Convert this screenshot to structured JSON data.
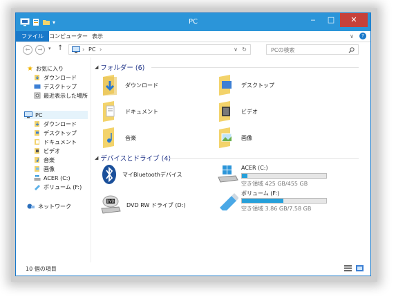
{
  "window": {
    "title": "PC"
  },
  "ribbon": {
    "tabs": [
      "ファイル",
      "コンピューター",
      "表示"
    ]
  },
  "address": {
    "path": [
      "PC"
    ],
    "search_placeholder": "PCの検索"
  },
  "nav": {
    "favorites_label": "お気に入り",
    "favorites": [
      "ダウンロード",
      "デスクトップ",
      "最近表示した場所"
    ],
    "pc_label": "PC",
    "pc_items": [
      "ダウンロード",
      "デスクトップ",
      "ドキュメント",
      "ビデオ",
      "音楽",
      "画像",
      "ACER (C:)",
      "ボリューム (F:)"
    ],
    "network_label": "ネットワーク"
  },
  "content": {
    "folders_header": "フォルダー (6)",
    "folders": [
      "ダウンロード",
      "デスクトップ",
      "ドキュメント",
      "ビデオ",
      "音楽",
      "画像"
    ],
    "devices_header": "デバイスとドライブ (4)",
    "devices": [
      {
        "name": "マイBluetoothデバイス"
      },
      {
        "name": "ACER (C:)",
        "space": "空き領域 425 GB/455 GB",
        "used_fraction": 0.066
      },
      {
        "name": "DVD RW ドライブ (D:)"
      },
      {
        "name": "ボリューム (F:)",
        "space": "空き領域 3.86 GB/7.58 GB",
        "used_fraction": 0.49
      }
    ]
  },
  "status": {
    "items": "10 個の項目"
  },
  "colors": {
    "accent": "#2b95d9",
    "file_tab": "#1979ca",
    "close": "#c7413a",
    "drive_fill": "#26a0da"
  }
}
